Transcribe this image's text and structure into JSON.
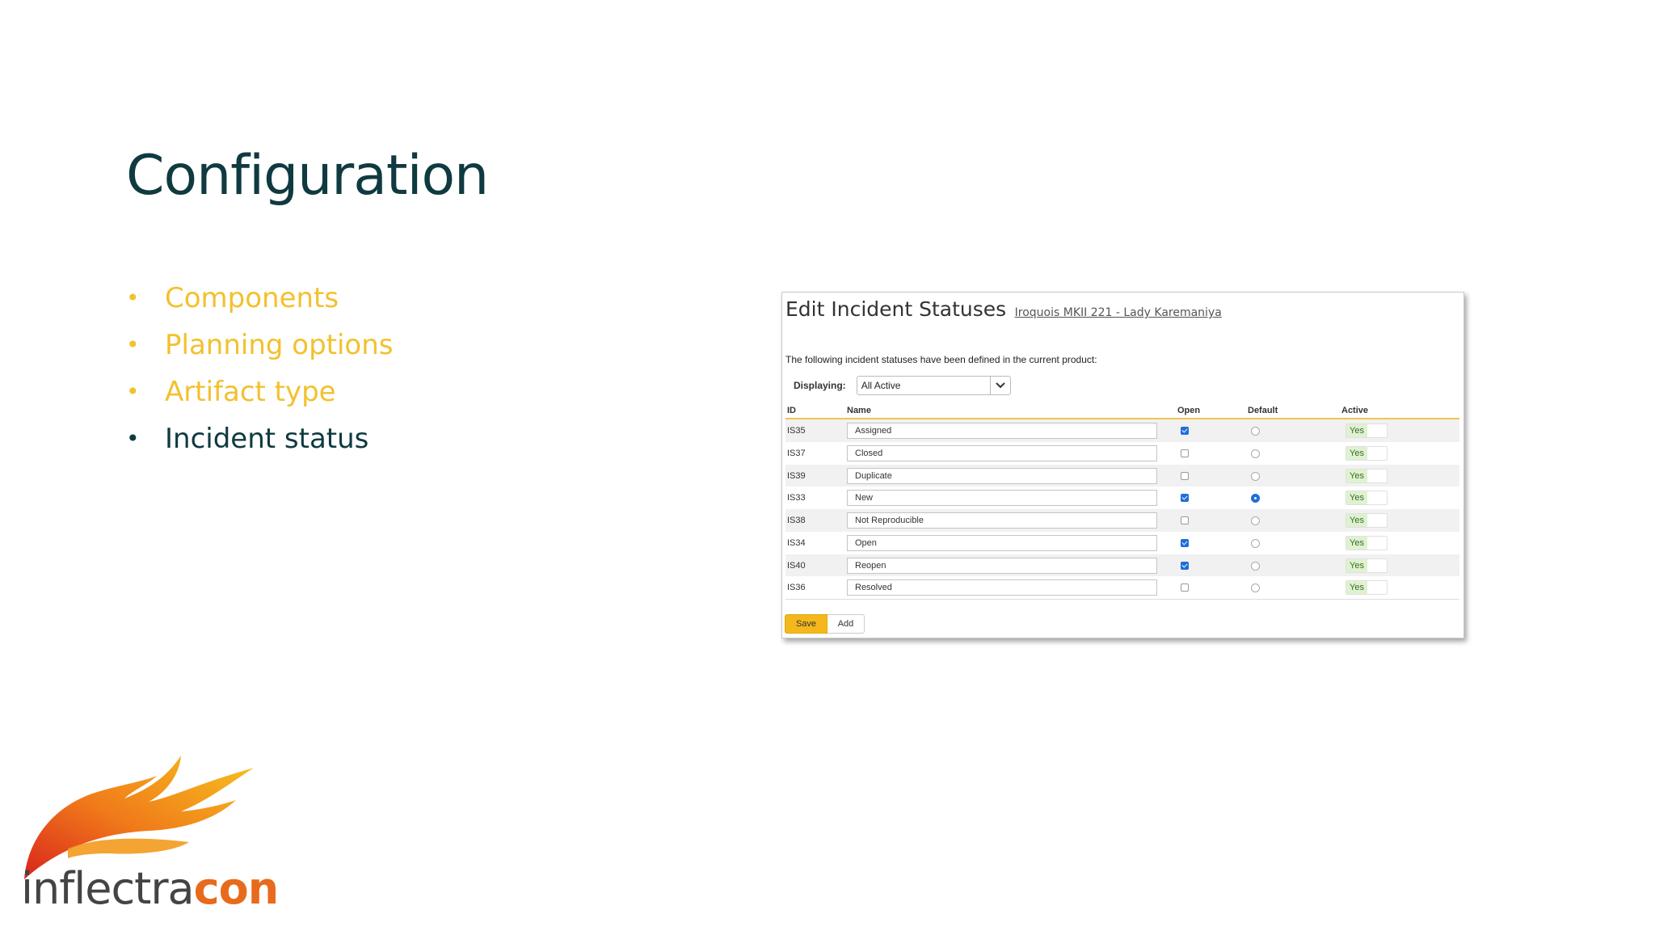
{
  "slide": {
    "title": "Configuration",
    "bullets": [
      {
        "label": "Components",
        "active": false
      },
      {
        "label": "Planning options",
        "active": false
      },
      {
        "label": "Artifact type",
        "active": false
      },
      {
        "label": "Incident status",
        "active": true
      }
    ]
  },
  "panel": {
    "title": "Edit Incident Statuses",
    "subtitle": "Iroquois MKII 221 - Lady Karemaniya",
    "description": "The following incident statuses have been defined in the current product:",
    "displaying_label": "Displaying:",
    "displaying_value": "All Active",
    "columns": {
      "id": "ID",
      "name": "Name",
      "open": "Open",
      "default": "Default",
      "active": "Active"
    },
    "rows": [
      {
        "id": "IS35",
        "name": "Assigned",
        "open": true,
        "default": false,
        "active": "Yes"
      },
      {
        "id": "IS37",
        "name": "Closed",
        "open": false,
        "default": false,
        "active": "Yes"
      },
      {
        "id": "IS39",
        "name": "Duplicate",
        "open": false,
        "default": false,
        "active": "Yes"
      },
      {
        "id": "IS33",
        "name": "New",
        "open": true,
        "default": true,
        "active": "Yes"
      },
      {
        "id": "IS38",
        "name": "Not Reproducible",
        "open": false,
        "default": false,
        "active": "Yes"
      },
      {
        "id": "IS34",
        "name": "Open",
        "open": true,
        "default": false,
        "active": "Yes"
      },
      {
        "id": "IS40",
        "name": "Reopen",
        "open": true,
        "default": false,
        "active": "Yes"
      },
      {
        "id": "IS36",
        "name": "Resolved",
        "open": false,
        "default": false,
        "active": "Yes"
      }
    ],
    "save_label": "Save",
    "add_label": "Add"
  },
  "logo": {
    "text_light": "inflectra",
    "text_bold": "con"
  },
  "colors": {
    "title": "#0f3a40",
    "bullet_inactive": "#f2c12e",
    "bullet_active": "#0f3a40",
    "accent": "#f5b81c",
    "checkbox_on": "#1e6fd9",
    "logo_orange": "#e86a1c"
  }
}
